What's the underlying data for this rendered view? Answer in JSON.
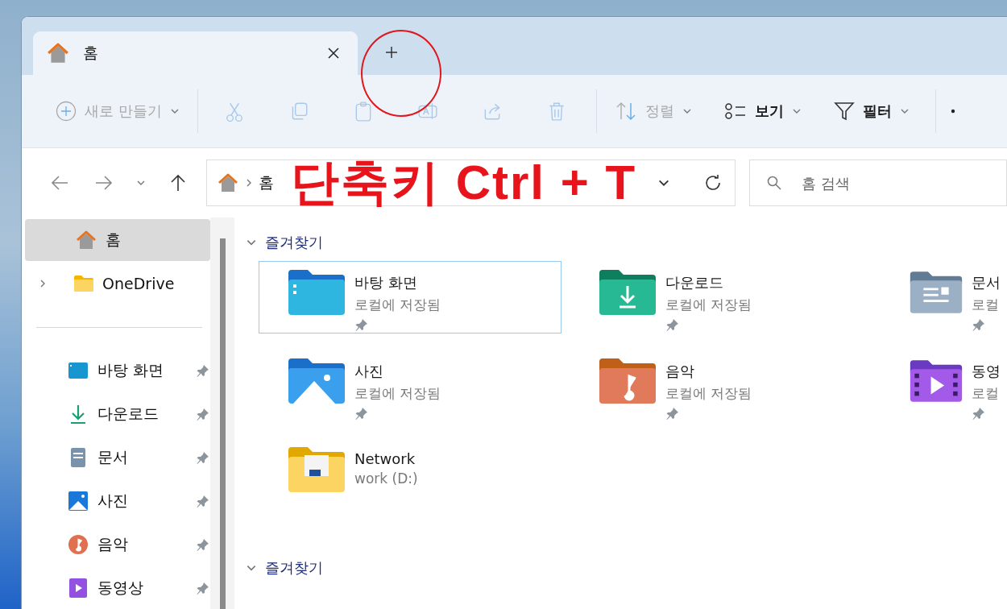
{
  "tabs": [
    {
      "label": "홈",
      "selected": true
    }
  ],
  "toolbar": {
    "new": {
      "label": "새로 만들기",
      "disabled": true
    },
    "actions": [
      {
        "kind": "cut",
        "disabled": true
      },
      {
        "kind": "copy",
        "disabled": true
      },
      {
        "kind": "paste",
        "disabled": true
      },
      {
        "kind": "rename",
        "disabled": true
      },
      {
        "kind": "share",
        "disabled": true
      },
      {
        "kind": "delete",
        "disabled": true
      }
    ],
    "menus": [
      {
        "kind": "sort",
        "label": "정렬",
        "disabled": true
      },
      {
        "kind": "view",
        "label": "보기",
        "disabled": false
      },
      {
        "kind": "filter",
        "label": "필터",
        "disabled": false
      }
    ]
  },
  "address": {
    "path": "홈"
  },
  "search": {
    "placeholder": "홈 검색"
  },
  "sidebar": {
    "items": [
      {
        "label": "홈",
        "kind": "home",
        "selected": true,
        "expandable": false
      },
      {
        "label": "OneDrive",
        "kind": "folder",
        "selected": false,
        "expandable": true
      }
    ],
    "pinned": [
      {
        "label": "바탕 화면",
        "kind": "desktop",
        "selected": false
      },
      {
        "label": "다운로드",
        "kind": "download",
        "selected": false
      },
      {
        "label": "문서",
        "kind": "documents",
        "selected": false
      },
      {
        "label": "사진",
        "kind": "pictures",
        "selected": false
      },
      {
        "label": "음악",
        "kind": "music",
        "selected": false
      },
      {
        "label": "동영상",
        "kind": "videos",
        "selected": false
      }
    ]
  },
  "sections": [
    {
      "title": "즐겨찾기",
      "expanded": true,
      "items": [
        {
          "name": "바탕 화면",
          "subtitle": "로컬에 저장됨",
          "kind": "desktop",
          "pinned": true,
          "selected": true
        },
        {
          "name": "다운로드",
          "subtitle": "로컬에 저장됨",
          "kind": "download",
          "pinned": true,
          "selected": false
        },
        {
          "name": "문서",
          "subtitle": "로컬",
          "kind": "documents",
          "pinned": true,
          "selected": false
        },
        {
          "name": "사진",
          "subtitle": "로컬에 저장됨",
          "kind": "pictures",
          "pinned": true,
          "selected": false
        },
        {
          "name": "음악",
          "subtitle": "로컬에 저장됨",
          "kind": "music",
          "pinned": true,
          "selected": false
        },
        {
          "name": "동영",
          "subtitle": "로컬",
          "kind": "videos",
          "pinned": true,
          "selected": false
        },
        {
          "name": "Network",
          "subtitle": "work (D:)",
          "kind": "network",
          "pinned": false,
          "selected": false
        }
      ]
    },
    {
      "title": "즐겨찾기",
      "expanded": true
    }
  ],
  "annotation": {
    "text": "단축키 Ctrl + T"
  }
}
